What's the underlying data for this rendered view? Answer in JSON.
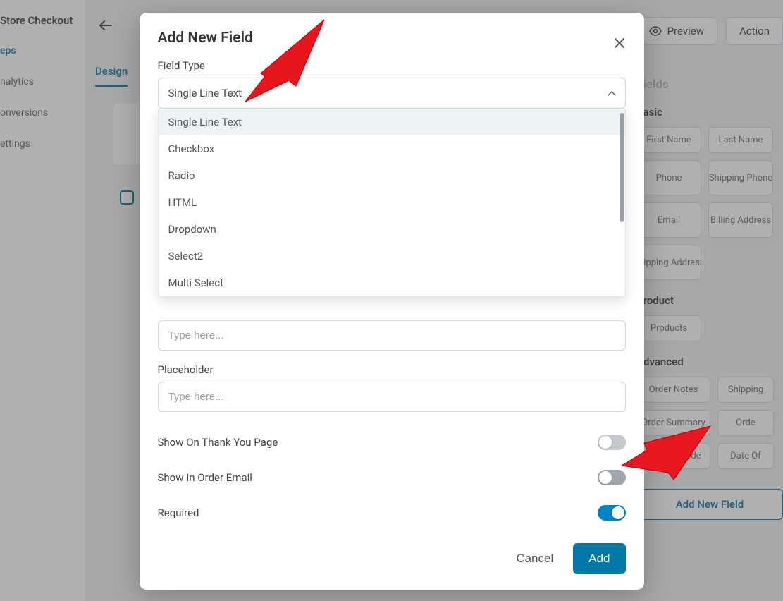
{
  "sidebar": {
    "title": "Store Checkout",
    "items": [
      {
        "label": "eps",
        "active": true
      },
      {
        "label": "nalytics"
      },
      {
        "label": "onversions"
      },
      {
        "label": "ettings"
      }
    ]
  },
  "topbar": {
    "preview": "Preview",
    "action": "Action"
  },
  "tabs": {
    "design": "Design"
  },
  "right_panel": {
    "heading_top": "Fields",
    "sections": {
      "basic": {
        "title": "Basic",
        "items": [
          "First Name",
          "Last Name",
          "Phone",
          "Shipping Phone",
          "Email",
          "Billing Address",
          "Shipping Address"
        ]
      },
      "product": {
        "title": "Product",
        "items": [
          "Products"
        ]
      },
      "advanced": {
        "title": "Advanced",
        "items": [
          "Order Notes",
          "Shipping",
          "Order Summary",
          "Orde",
          "Coupon Code",
          "Date Of"
        ]
      }
    },
    "add_button": "Add New Field"
  },
  "modal": {
    "title": "Add New Field",
    "field_type": {
      "label": "Field Type",
      "selected": "Single Line Text",
      "options": [
        "Single Line Text",
        "Checkbox",
        "Radio",
        "HTML",
        "Dropdown",
        "Select2",
        "Multi Select"
      ]
    },
    "input1": {
      "placeholder": "Type here...",
      "value": ""
    },
    "placeholder_field": {
      "label": "Placeholder",
      "placeholder": "Type here...",
      "value": ""
    },
    "toggles": {
      "thank_you": {
        "label": "Show On Thank You Page",
        "on": false
      },
      "order_email": {
        "label": "Show In Order Email",
        "on": false
      },
      "required": {
        "label": "Required",
        "on": true
      }
    },
    "footer": {
      "cancel": "Cancel",
      "add": "Add"
    }
  }
}
